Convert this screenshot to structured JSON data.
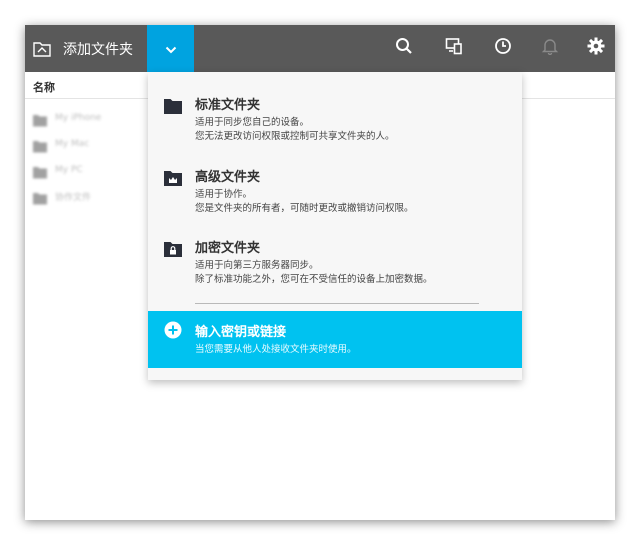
{
  "toolbar": {
    "add_folder_label": "添加文件夹",
    "icons": [
      "folder-add-icon",
      "chevron-down-icon",
      "search-icon",
      "devices-icon",
      "clock-icon",
      "bell-icon",
      "gear-icon"
    ]
  },
  "file_list": {
    "column_name": "名称",
    "items": [
      {
        "name": "My iPhone",
        "icon": "folder-icon"
      },
      {
        "name": "My Mac",
        "icon": "folder-icon"
      },
      {
        "name": "My PC",
        "icon": "folder-icon"
      },
      {
        "name": "协作文件",
        "icon": "folder-icon"
      }
    ]
  },
  "menu": {
    "standard": {
      "title": "标准文件夹",
      "desc1": "适用于同步您自己的设备。",
      "desc2": "您无法更改访问权限或控制可共享文件夹的人。",
      "icon": "folder-icon"
    },
    "advanced": {
      "title": "高级文件夹",
      "desc1": "适用于协作。",
      "desc2": "您是文件夹的所有者，可随时更改或撤销访问权限。",
      "icon": "crown-folder-icon"
    },
    "encrypted": {
      "title": "加密文件夹",
      "desc1": "适用于向第三方服务器同步。",
      "desc2": "除了标准功能之外，您可在不受信任的设备上加密数据。",
      "icon": "lock-folder-icon"
    },
    "enter_key": {
      "title": "输入密钥或链接",
      "desc1": "当您需要从他人处接收文件夹时使用。",
      "icon": "plus-circle-icon"
    }
  },
  "colors": {
    "toolbar_bg": "#595959",
    "accent": "#00a3e0",
    "highlight": "#00c2f0"
  }
}
